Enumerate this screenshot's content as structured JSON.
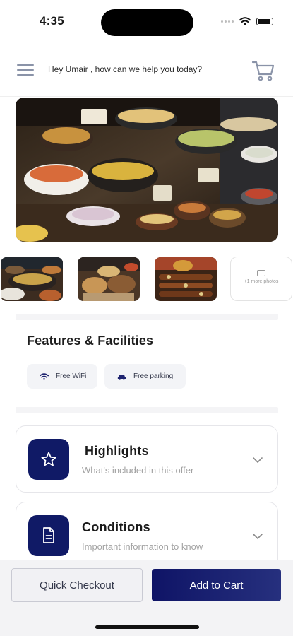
{
  "status_bar": {
    "time": "4:35"
  },
  "header": {
    "greeting": "Hey Umair , how can we help you today?"
  },
  "gallery": {
    "more_photos_label": "+1 more photos"
  },
  "features": {
    "title": "Features & Facilities",
    "chips": [
      {
        "label": "Free WiFi",
        "icon": "wifi-icon"
      },
      {
        "label": "Free parking",
        "icon": "car-icon"
      }
    ]
  },
  "cards": [
    {
      "title": "Highlights",
      "subtitle": "What's included in this offer",
      "icon": "star-icon"
    },
    {
      "title": "Conditions",
      "subtitle": "Important information to know",
      "icon": "document-icon"
    }
  ],
  "actions": {
    "quick_checkout": "Quick Checkout",
    "add_to_cart": "Add to Cart"
  },
  "colors": {
    "primary": "#101a66",
    "muted_text": "#a2a2a2",
    "chip_bg": "#f3f4f7"
  }
}
